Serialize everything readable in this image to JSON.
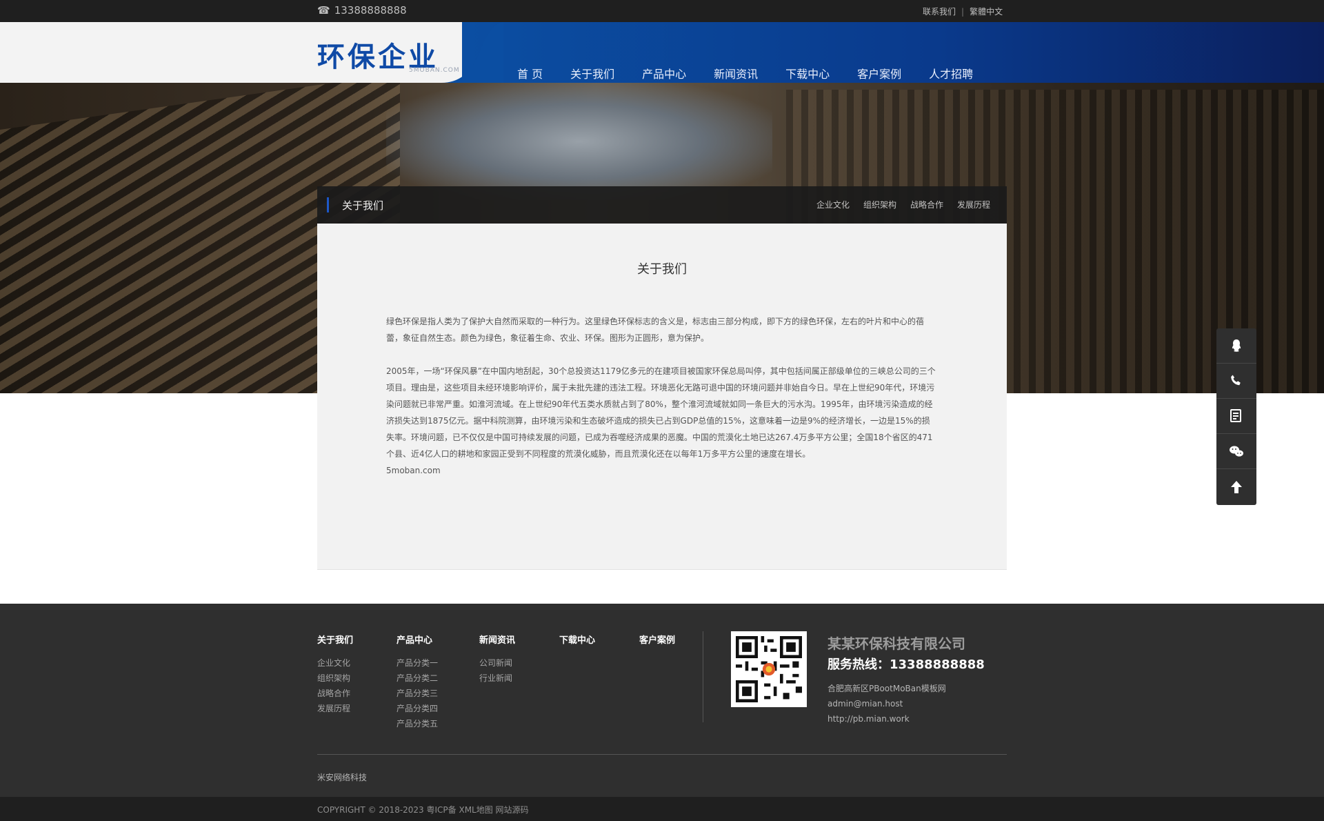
{
  "topbar": {
    "phone": "13388888888",
    "contact": "联系我们",
    "lang": "繁體中文",
    "sep": "|"
  },
  "header": {
    "logo": "环保企业",
    "logo_sub": "5MOBAN.COM",
    "nav": [
      "首 页",
      "关于我们",
      "产品中心",
      "新闻资讯",
      "下载中心",
      "客户案例",
      "人才招聘"
    ]
  },
  "subnav": {
    "title": "关于我们",
    "links": [
      "企业文化",
      "组织架构",
      "战略合作",
      "发展历程"
    ]
  },
  "content": {
    "heading": "关于我们",
    "para1": "绿色环保是指人类为了保护大自然而采取的一种行为。这里绿色环保标志的含义是，标志由三部分构成，即下方的绿色环保，左右的叶片和中心的蓓蕾，象征自然生态。颜色为绿色，象征着生命、农业、环保。图形为正圆形，意为保护。",
    "para2": "2005年，一场“环保风暴”在中国内地刮起，30个总投资达1179亿多元的在建项目被国家环保总局叫停，其中包括间属正部级单位的三峡总公司的三个项目。理由是，这些项目未经环境影响评价，属于未批先建的违法工程。环境恶化无路可退中国的环境问题并非始自今日。早在上世纪90年代，环境污染问题就已非常严重。如淮河流域。在上世纪90年代五类水质就占到了80%，整个淮河流域就如同一条巨大的污水沟。1995年，由环境污染造成的经济损失达到1875亿元。据中科院测算，由环境污染和生态破坏造成的损失已占到GDP总值的15%，这意味着一边是9%的经济增长，一边是15%的损失率。环境问题，已不仅仅是中国可持续发展的问题，已成为吞噬经济成果的恶魔。中国的荒漠化土地已达267.4万多平方公里；全国18个省区的471个县、近4亿人口的耕地和家园正受到不同程度的荒漠化威胁，而且荒漠化还在以每年1万多平方公里的速度在增长。",
    "para3": "5moban.com"
  },
  "sidebar": {
    "icons": [
      "qq-icon",
      "phone-icon",
      "message-icon",
      "wechat-icon",
      "arrow-up-icon"
    ]
  },
  "footer": {
    "cols": [
      {
        "title": "关于我们",
        "links": [
          "企业文化",
          "组织架构",
          "战略合作",
          "发展历程"
        ]
      },
      {
        "title": "产品中心",
        "links": [
          "产品分类一",
          "产品分类二",
          "产品分类三",
          "产品分类四",
          "产品分类五"
        ]
      },
      {
        "title": "新闻资讯",
        "links": [
          "公司新闻",
          "行业新闻"
        ]
      },
      {
        "title": "下载中心",
        "links": []
      },
      {
        "title": "客户案例",
        "links": []
      }
    ],
    "company": "某某环保科技有限公司",
    "hotline": "服务热线：13388888888",
    "address": "合肥高新区PBootMoBan模板网",
    "email": "admin@mian.host",
    "site": "http://pb.mian.work",
    "small": "米安网络科技",
    "copyright": "COPYRIGHT © 2018-2023 粤ICP备 XML地图 网站源码"
  }
}
